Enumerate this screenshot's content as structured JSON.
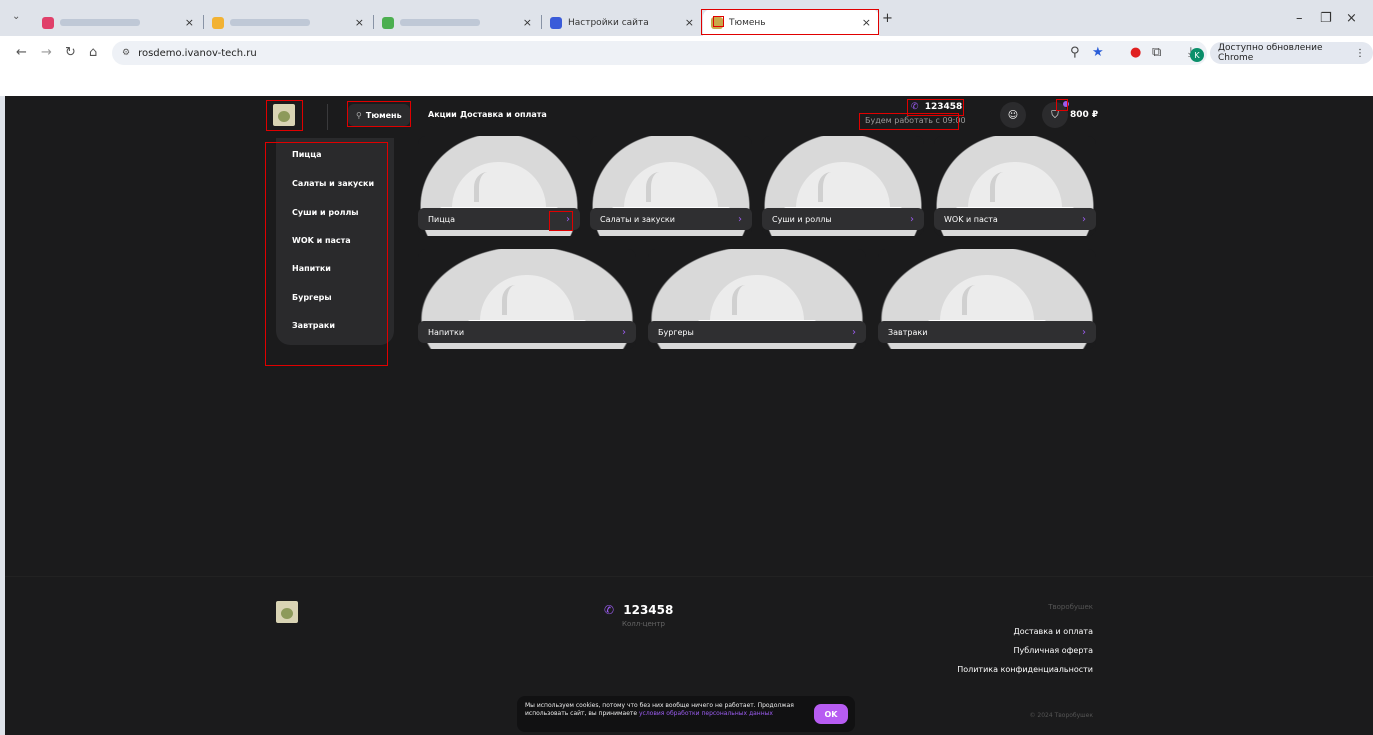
{
  "browser": {
    "tabs": [
      {
        "label": "",
        "blurred": true,
        "favicon_color": "#e0406a"
      },
      {
        "label": "",
        "blurred": true,
        "favicon_color": "#f2b233"
      },
      {
        "label": "",
        "blurred": true,
        "favicon_color": "#4caf50"
      },
      {
        "label": "Настройки сайта",
        "blurred": false,
        "favicon_color": "#3a5bd9"
      },
      {
        "label": "Тюмень",
        "blurred": false,
        "favicon_color": "#c9a84a",
        "active": true
      }
    ],
    "close_glyph": "×",
    "new_tab_glyph": "+",
    "url": "rosdemo.ivanov-tech.ru",
    "update_button": "Доступно обновление Chrome",
    "profile_initial": "K"
  },
  "site": {
    "city": "Тюмень",
    "nav": [
      "Акции",
      "Доставка и оплата"
    ],
    "phone": "123458",
    "work_hours": "Будем работать с 09:00",
    "cart_total": "800 ₽",
    "menu": [
      "Пицца",
      "Салаты и закуски",
      "Суши и роллы",
      "WOK и паста",
      "Напитки",
      "Бургеры",
      "Завтраки"
    ],
    "cards_row1": [
      "Пицца",
      "Салаты и закуски",
      "Суши и роллы",
      "WOK и паста"
    ],
    "cards_row2": [
      "Напитки",
      "Бургеры",
      "Завтраки"
    ],
    "arrow_glyph": "›"
  },
  "footer": {
    "phone": "123458",
    "phone_caption": "Колл-центр",
    "brand": "Творобушек",
    "links": [
      "Доставка и оплата",
      "Публичная оферта",
      "Политика конфиденциальности"
    ],
    "copyright": "© 2024 Творобушек"
  },
  "cookie": {
    "text": "Мы используем cookies, потому что без них вообще ничего не работает. Продолжая использовать сайт, вы принимаете",
    "link": "условия обработки персональных данных",
    "ok": "OK"
  },
  "colors": {
    "accent": "#9b5cf0",
    "page_bg": "#1b1b1c",
    "highlight": "#e00000"
  }
}
